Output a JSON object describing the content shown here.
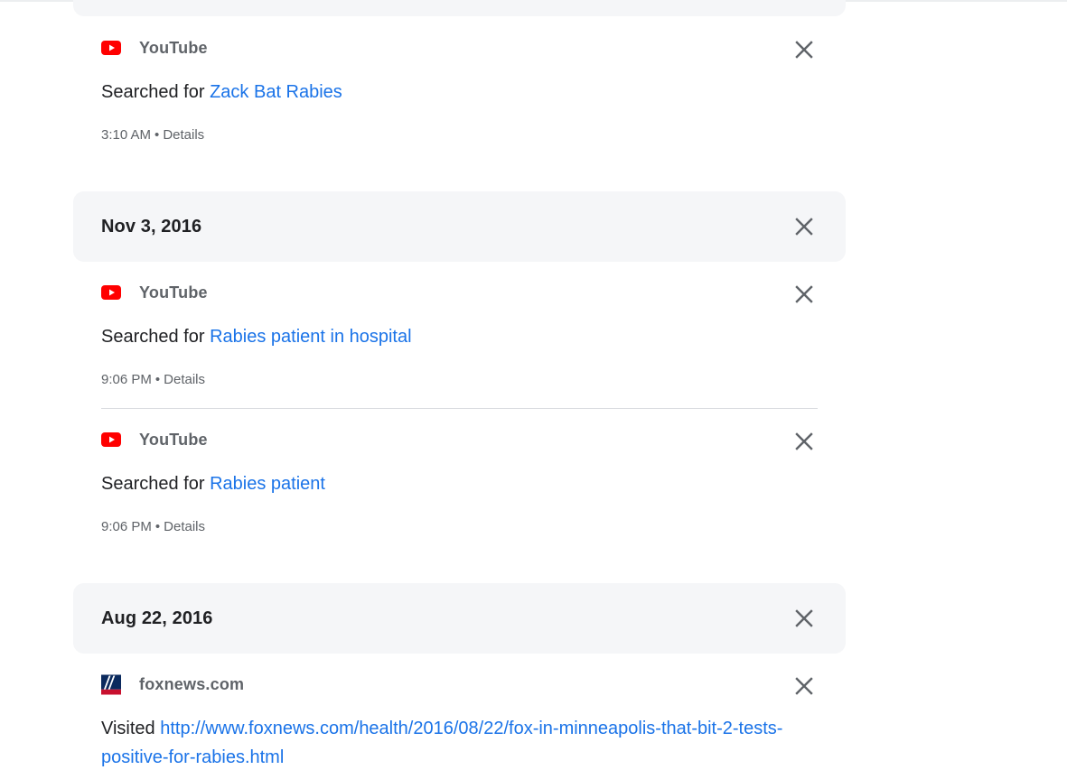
{
  "top_entry": {
    "source": "YouTube",
    "action_prefix": "Searched for",
    "link": "Zack Bat Rabies",
    "time": "3:10 AM",
    "details": "Details"
  },
  "groups": [
    {
      "date": "Nov 3, 2016",
      "entries": [
        {
          "source": "YouTube",
          "action_prefix": "Searched for",
          "link": "Rabies patient in hospital",
          "time": "9:06 PM",
          "details": "Details"
        },
        {
          "source": "YouTube",
          "action_prefix": "Searched for",
          "link": "Rabies patient",
          "time": "9:06 PM",
          "details": "Details"
        }
      ]
    },
    {
      "date": "Aug 22, 2016",
      "entries": [
        {
          "source": "foxnews.com",
          "action_prefix": "Visited",
          "link": "http://www.foxnews.com/health/2016/08/22/fox-in-minneapolis-that-bit-2-tests-positive-for-rabies.html"
        }
      ]
    }
  ],
  "separator": "•",
  "colors": {
    "link": "#1a73e8",
    "youtube_red": "#ff0000",
    "date_bar_bg": "#f5f6f8",
    "close_icon": "#5f6368"
  },
  "icons": {
    "youtube": "youtube-logo-icon",
    "foxnews": "foxnews-logo-icon",
    "close": "close-icon"
  }
}
